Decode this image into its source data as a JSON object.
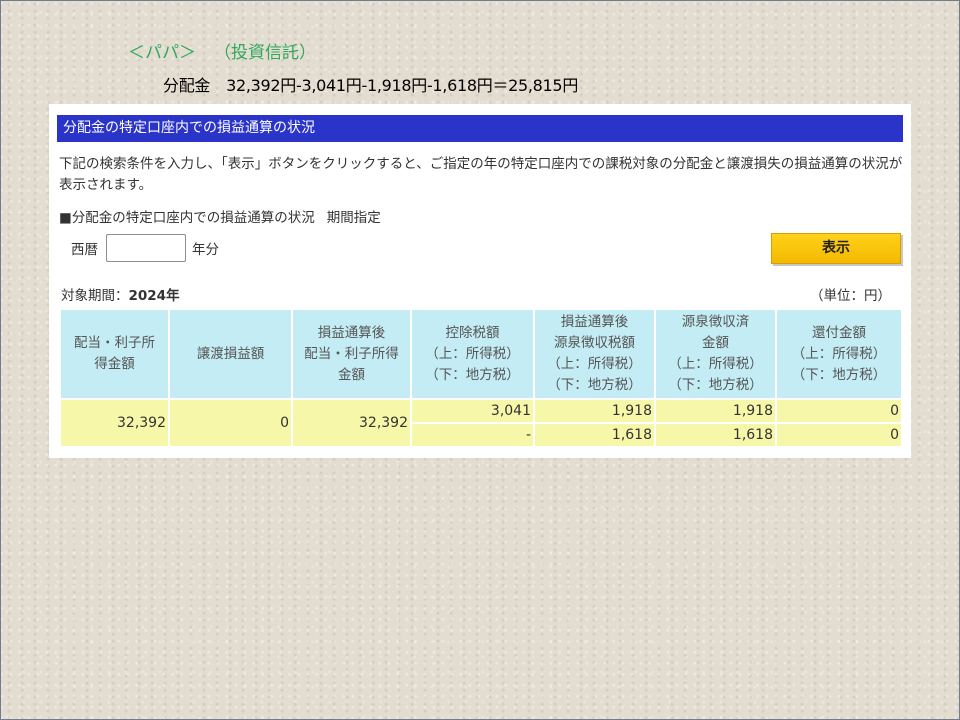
{
  "heading": {
    "name": "＜パパ＞",
    "type": "（投資信託）"
  },
  "formula": {
    "label": "分配金",
    "value": "32,392円-3,041円-1,918円-1,618円＝25,815円"
  },
  "panel": {
    "title": "分配金の特定口座内での損益通算の状況",
    "description": "下記の検索条件を入力し、「表示」ボタンをクリックすると、ご指定の年の特定口座内での課税対象の分配金と譲渡損失の損益通算の状況が表示されます。",
    "section_title": "■分配金の特定口座内での損益通算の状況",
    "period_label": "期間指定",
    "year_prefix": "西暦",
    "year_value": "",
    "year_suffix": "年分",
    "show_button": "表示",
    "target_label": "対象期間：",
    "target_value": "2024年",
    "unit": "（単位：円）"
  },
  "table": {
    "headers": [
      [
        "配当・利子所",
        "得金額"
      ],
      [
        "譲渡損益額"
      ],
      [
        "損益通算後",
        "配当・利子所得",
        "金額"
      ],
      [
        "控除税額",
        "（上：所得税）",
        "（下：地方税）"
      ],
      [
        "損益通算後",
        "源泉徴収税額",
        "（上：所得税）",
        "（下：地方税）"
      ],
      [
        "源泉徴収済",
        "金額",
        "（上：所得税）",
        "（下：地方税）"
      ],
      [
        "還付金額",
        "（上：所得税）",
        "（下：地方税）"
      ]
    ],
    "row": {
      "dividend_income": "32,392",
      "transfer_pl": "0",
      "after_offset_income": "32,392",
      "deducted_tax": {
        "upper": "3,041",
        "lower": "-"
      },
      "withholding_after": {
        "upper": "1,918",
        "lower": "1,618"
      },
      "withheld": {
        "upper": "1,918",
        "lower": "1,618"
      },
      "refund": {
        "upper": "0",
        "lower": "0"
      }
    }
  }
}
